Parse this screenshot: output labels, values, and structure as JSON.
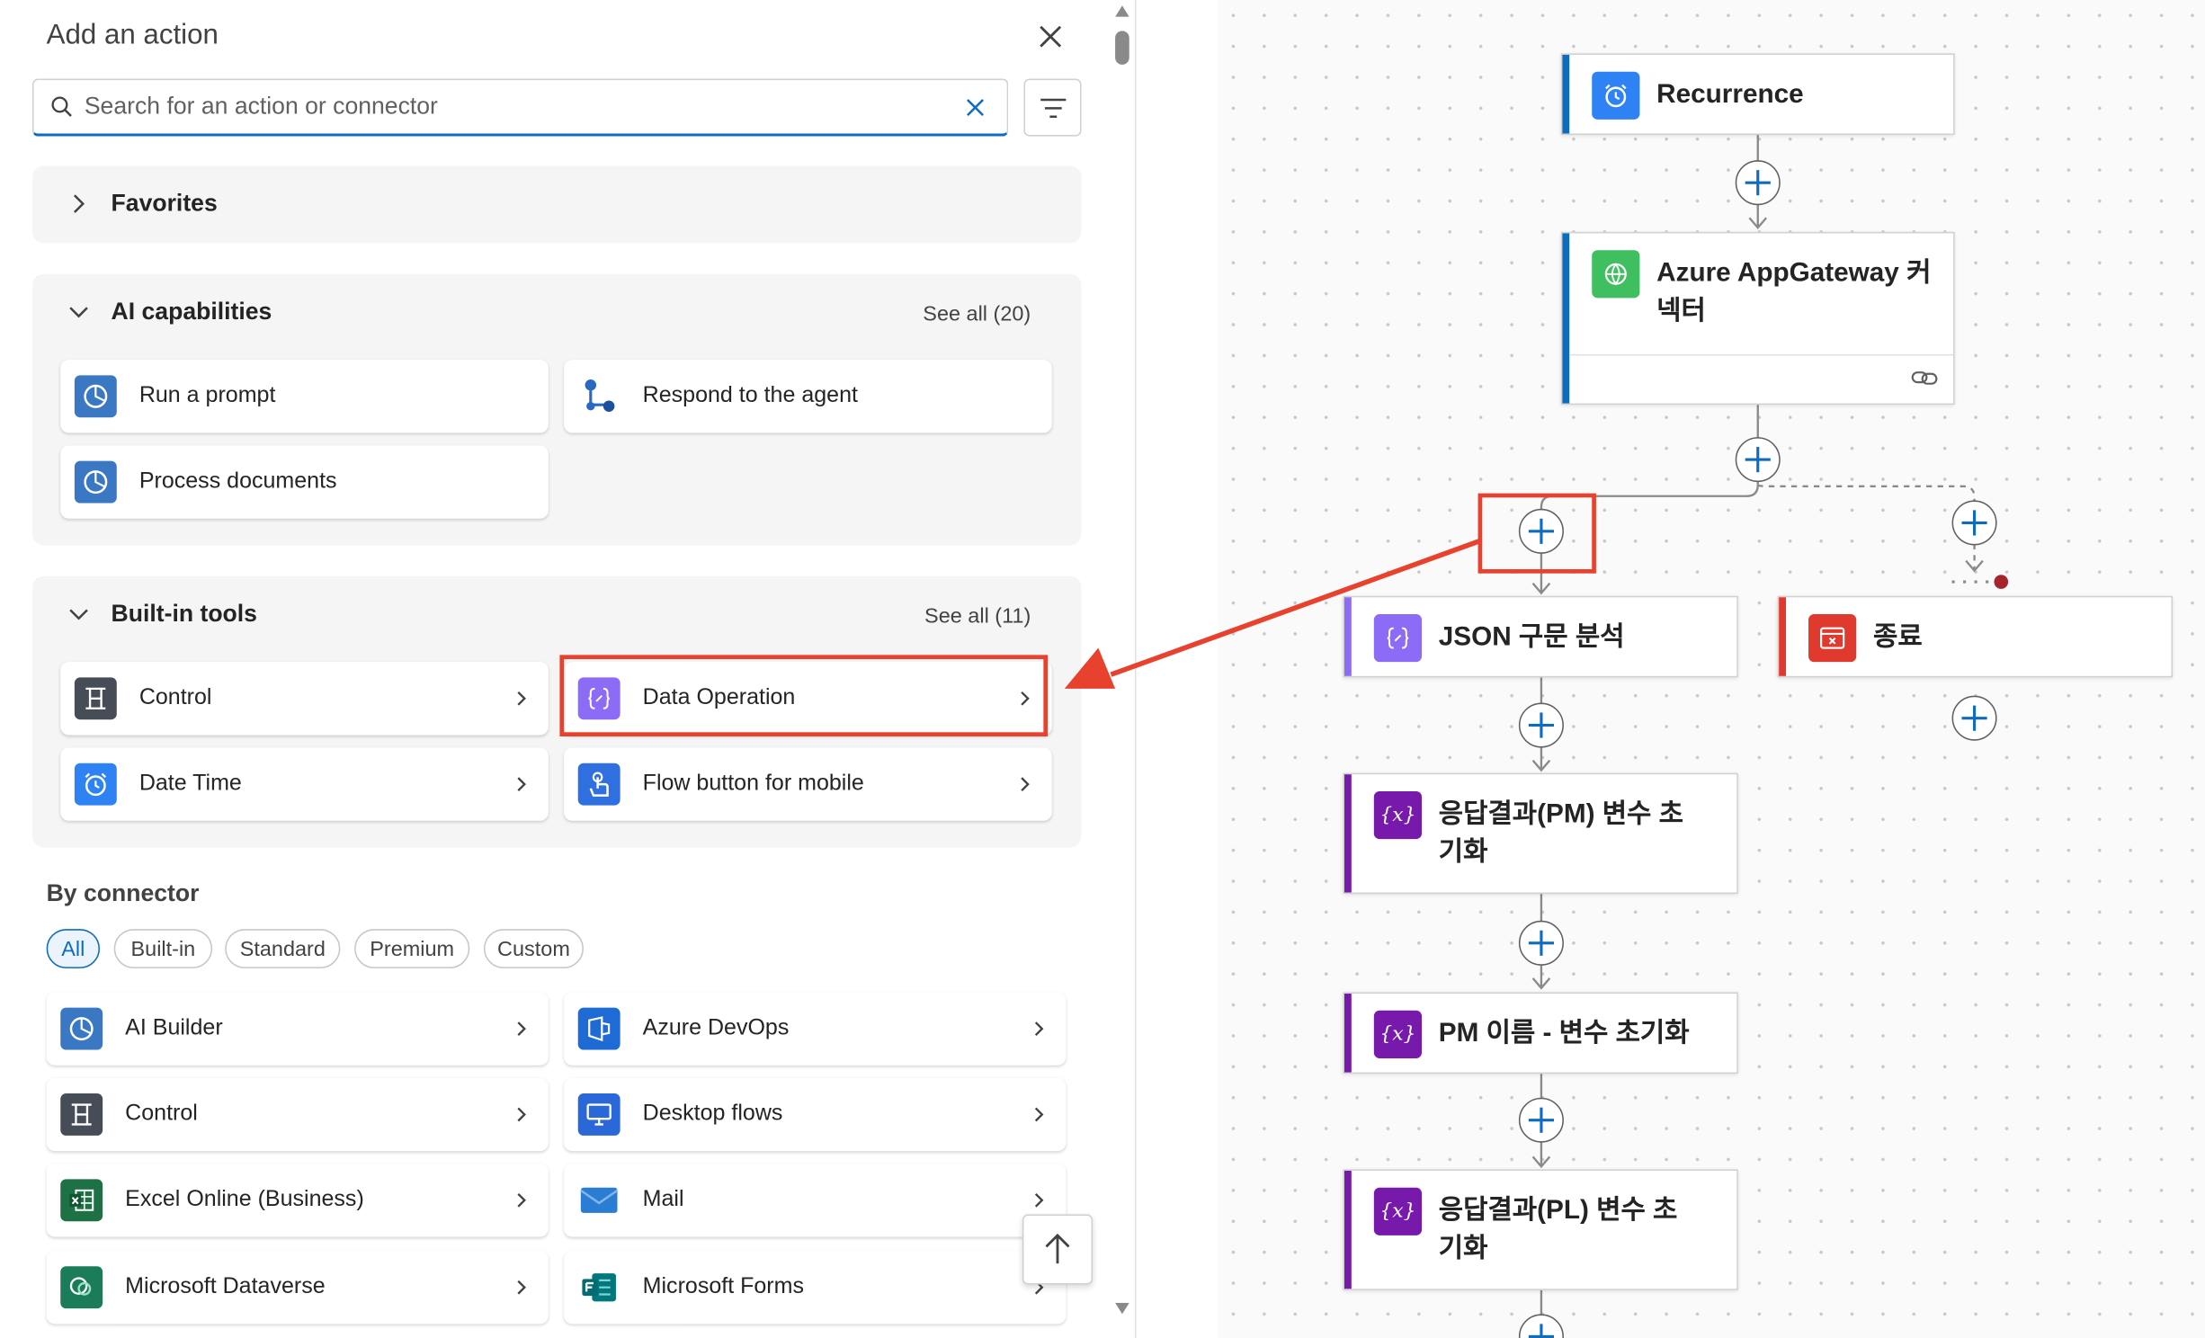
{
  "panel": {
    "title": "Add an action",
    "search": {
      "placeholder": "Search for an action or connector",
      "value": ""
    },
    "favorites": {
      "label": "Favorites"
    },
    "ai": {
      "label": "AI capabilities",
      "see_all": "See all (20)",
      "items": [
        {
          "label": "Run a prompt",
          "icon": "ai-builder-icon"
        },
        {
          "label": "Respond to the agent",
          "icon": "agent-icon"
        },
        {
          "label": "Process documents",
          "icon": "ai-builder-icon"
        }
      ]
    },
    "builtin": {
      "label": "Built-in tools",
      "see_all": "See all (11)",
      "items": [
        {
          "label": "Control",
          "icon": "control-icon"
        },
        {
          "label": "Data Operation",
          "icon": "data-operation-icon"
        },
        {
          "label": "Date Time",
          "icon": "clock-icon"
        },
        {
          "label": "Flow button for mobile",
          "icon": "touch-icon"
        }
      ]
    },
    "by_connector": {
      "label": "By connector",
      "filters": [
        "All",
        "Built-in",
        "Standard",
        "Premium",
        "Custom"
      ],
      "active_filter": "All",
      "items": [
        {
          "label": "AI Builder",
          "icon": "ai-builder-icon"
        },
        {
          "label": "Azure DevOps",
          "icon": "azure-devops-icon"
        },
        {
          "label": "Control",
          "icon": "control-icon"
        },
        {
          "label": "Desktop flows",
          "icon": "desktop-flows-icon"
        },
        {
          "label": "Excel Online (Business)",
          "icon": "excel-icon"
        },
        {
          "label": "Mail",
          "icon": "mail-icon"
        },
        {
          "label": "Microsoft Dataverse",
          "icon": "dataverse-icon"
        },
        {
          "label": "Microsoft Forms",
          "icon": "forms-icon"
        }
      ]
    }
  },
  "flow": {
    "nodes": {
      "recurrence": "Recurrence",
      "appgateway_l1": "Azure AppGateway 커",
      "appgateway_l2": "넥터",
      "json": "JSON 구문 분석",
      "end": "종료",
      "var_pm_l1": "응답결과(PM) 변수 초",
      "var_pm_l2": "기화",
      "pm_name": "PM 이름 - 변수 초기화",
      "var_pl_l1": "응답결과(PL) 변수 초",
      "var_pl_l2": "기화"
    }
  },
  "colors": {
    "accent": "#0f6cbd",
    "highlight": "#e8422f",
    "variable": "#7719aa",
    "data_operation": "#8c6cf7",
    "terminate": "#e03a2e"
  }
}
